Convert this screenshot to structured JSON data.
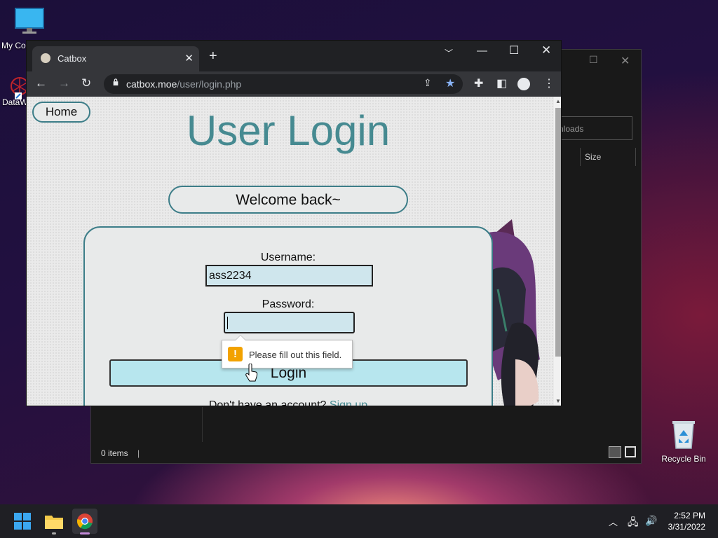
{
  "desktop": {
    "icons": [
      {
        "label": "My Co"
      },
      {
        "label": "DataW"
      },
      {
        "label": "Recycle Bin"
      }
    ]
  },
  "explorer": {
    "search_placeholder": "nloads",
    "size_header": "Size",
    "status": "0 items"
  },
  "browser": {
    "tab_title": "Catbox",
    "url_domain": "catbox.moe",
    "url_path": "/user/login.php"
  },
  "page": {
    "home_label": "Home",
    "title": "User Login",
    "welcome": "Welcome back~",
    "username_label": "Username:",
    "username_value": "ass2234",
    "password_label": "Password:",
    "password_value": "",
    "login_label": "Login",
    "signup_prompt": "Don't have an account?",
    "signup_link": "Sign up",
    "validation_message": "Please fill out this field."
  },
  "taskbar": {
    "time": "2:52 PM",
    "date": "3/31/2022"
  },
  "colors": {
    "accent": "#468a91",
    "button_bg": "#b7e6ee",
    "field_bg": "#cfe6ed"
  }
}
